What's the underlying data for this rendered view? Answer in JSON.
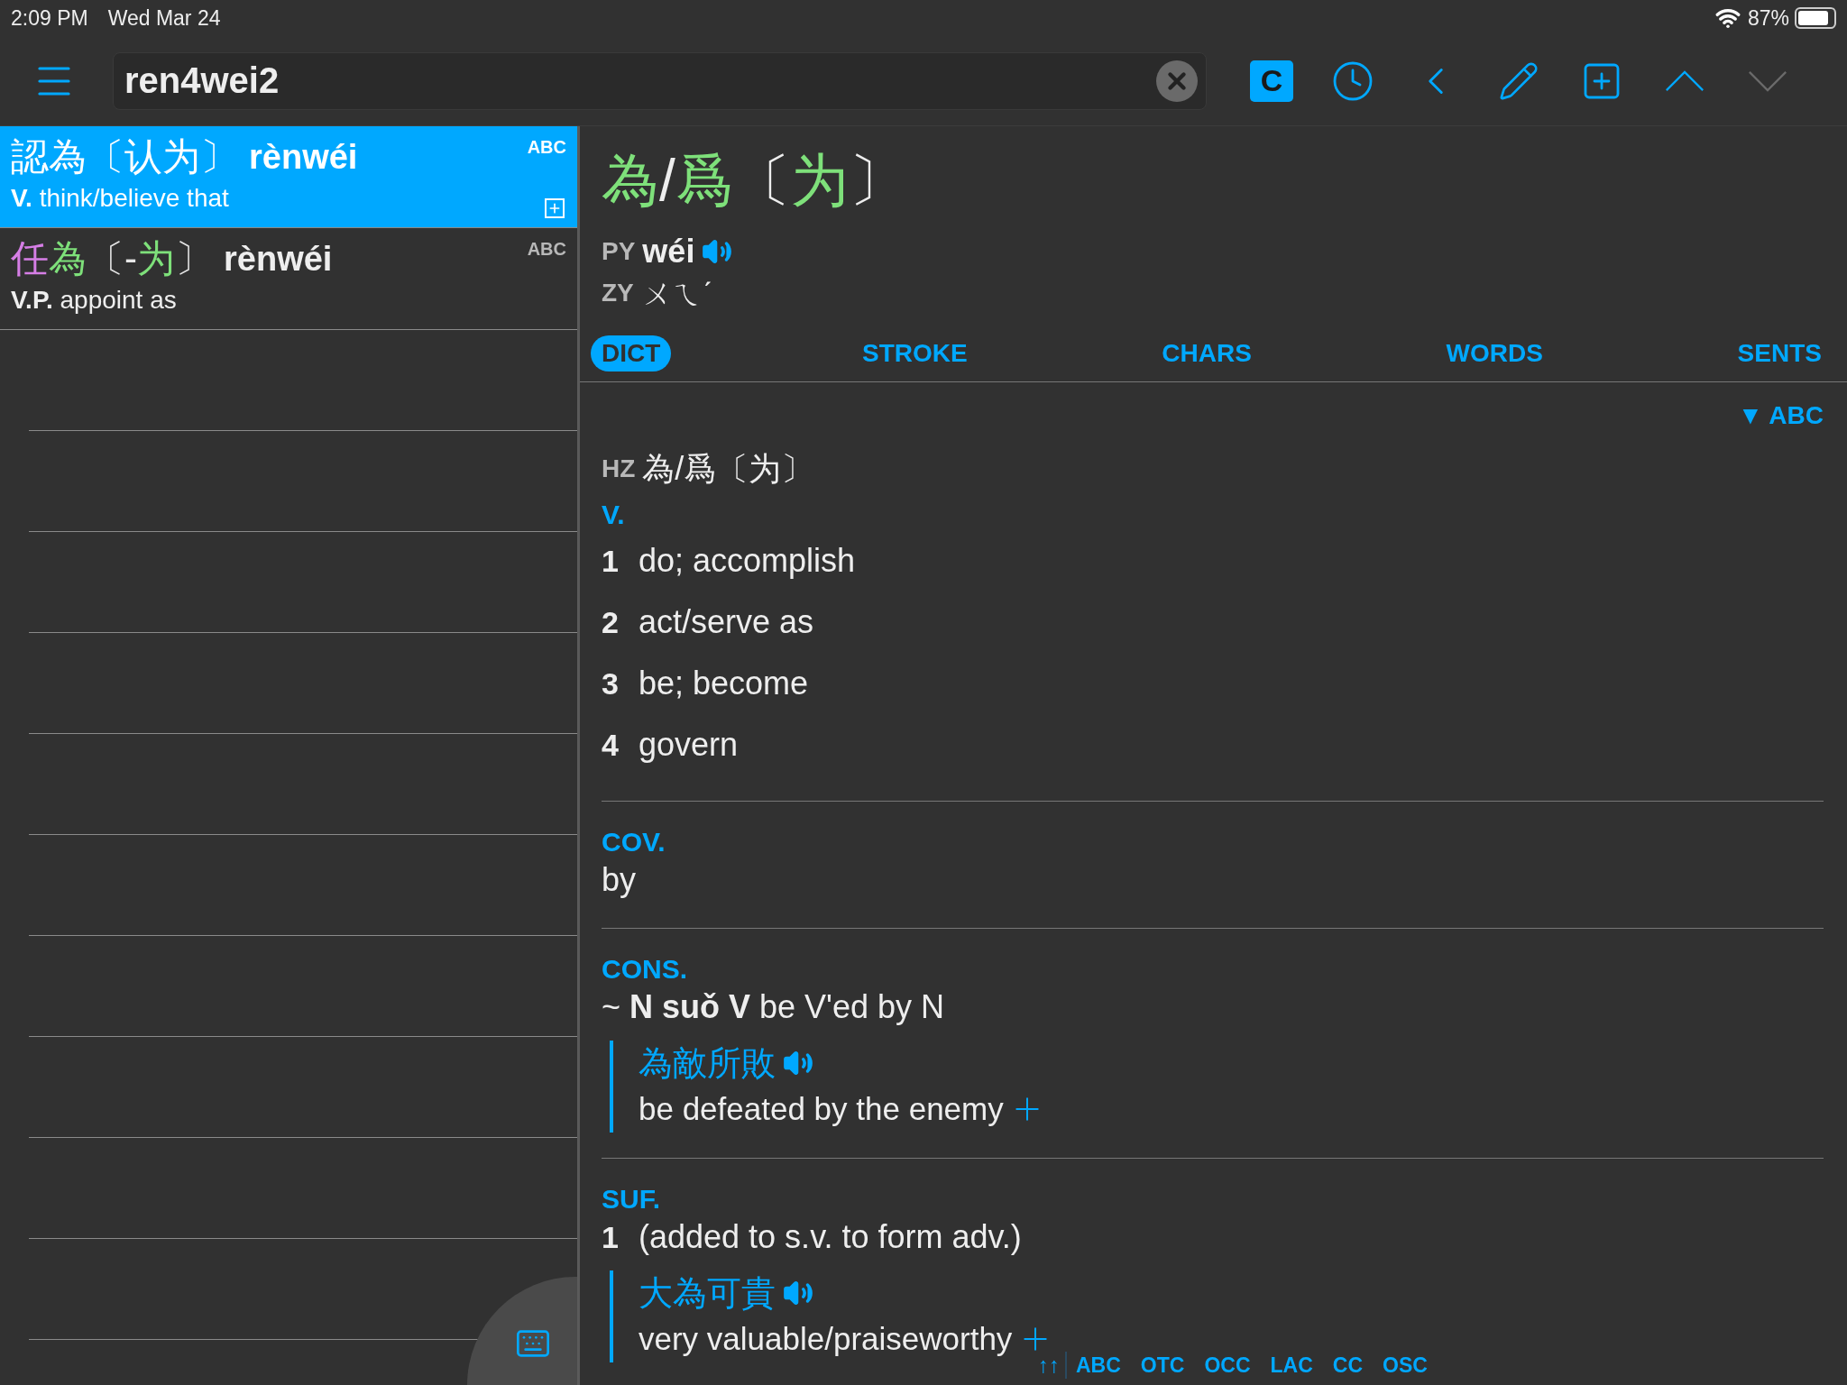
{
  "status_bar": {
    "time": "2:09 PM",
    "date": "Wed Mar 24",
    "battery": "87%"
  },
  "toolbar": {
    "search": {
      "value": "ren4wei2"
    },
    "script_label": "C",
    "nav_up": {
      "disabled": false
    },
    "nav_down": {
      "disabled": true
    }
  },
  "results": [
    {
      "selected": true,
      "headword": [
        {
          "text": "認為",
          "color": "#ffffff"
        },
        {
          "text": "〔",
          "color": "#ffffff"
        },
        {
          "text": "认为",
          "color": "#ffffff"
        },
        {
          "text": "〕",
          "color": "#ffffff"
        }
      ],
      "pinyin": "rènwéi",
      "source": "ABC",
      "gloss": "**V.** think/believe that"
    },
    {
      "selected": false,
      "headword": [
        {
          "text": "任",
          "color": "#d67ee6"
        },
        {
          "text": "為",
          "color": "#7ee07a"
        },
        {
          "text": "〔",
          "color": "#e6e6e6"
        },
        {
          "text": "-",
          "color": "#e6e6e6"
        },
        {
          "text": "为",
          "color": "#7ee07a"
        },
        {
          "text": "〕",
          "color": "#e6e6e6"
        }
      ],
      "pinyin": "rènwéi",
      "source": "ABC",
      "gloss": "**V.P.** appoint as"
    }
  ],
  "entry": {
    "headword": [
      {
        "text": "為",
        "color": "#7ee07a"
      },
      {
        "text": "/",
        "color": "#eeeeee"
      },
      {
        "text": "爲",
        "color": "#7ee07a"
      },
      {
        "text": "〔",
        "color": "#eeeeee"
      },
      {
        "text": "为",
        "color": "#7ee07a"
      },
      {
        "text": "〕",
        "color": "#eeeeee"
      }
    ],
    "py_label": "PY",
    "pinyin": "wéi",
    "zy_label": "ZY",
    "zhuyin": "ㄨㄟˊ",
    "tabs": [
      {
        "label": "DICT",
        "selected": true
      },
      {
        "label": "STROKE",
        "selected": false
      },
      {
        "label": "CHARS",
        "selected": false
      },
      {
        "label": "WORDS",
        "selected": false
      },
      {
        "label": "SENTS",
        "selected": false
      }
    ],
    "source": "▼ ABC",
    "hz_label": "HZ",
    "hz": "為/爲〔为〕",
    "sections": [
      {
        "pos": "V.",
        "senses": [
          {
            "number": "1",
            "text": "do; accomplish"
          },
          {
            "number": "2",
            "text": "act/serve as"
          },
          {
            "number": "3",
            "text": "be; become"
          },
          {
            "number": "4",
            "text": "govern"
          }
        ]
      },
      {
        "pos": "COV.",
        "senses": [
          {
            "text": "by"
          }
        ]
      },
      {
        "pos": "CONS.",
        "senses": [
          {
            "text": "~ **N suǒ V** be V'ed by N",
            "examples": [
              {
                "hanzi": "為敵所敗",
                "english": "be defeated by the enemy"
              }
            ]
          }
        ]
      },
      {
        "pos": "SUF.",
        "senses": [
          {
            "number": "1",
            "text": "(added to s.v. to form adv.)",
            "examples": [
              {
                "hanzi": "大為可貴",
                "english": "very valuable/praiseworthy"
              }
            ]
          }
        ]
      }
    ]
  },
  "floating_bar": {
    "arrows": "↑↑",
    "sources": [
      "ABC",
      "OTC",
      "OCC",
      "LAC",
      "CC",
      "OSC"
    ]
  }
}
